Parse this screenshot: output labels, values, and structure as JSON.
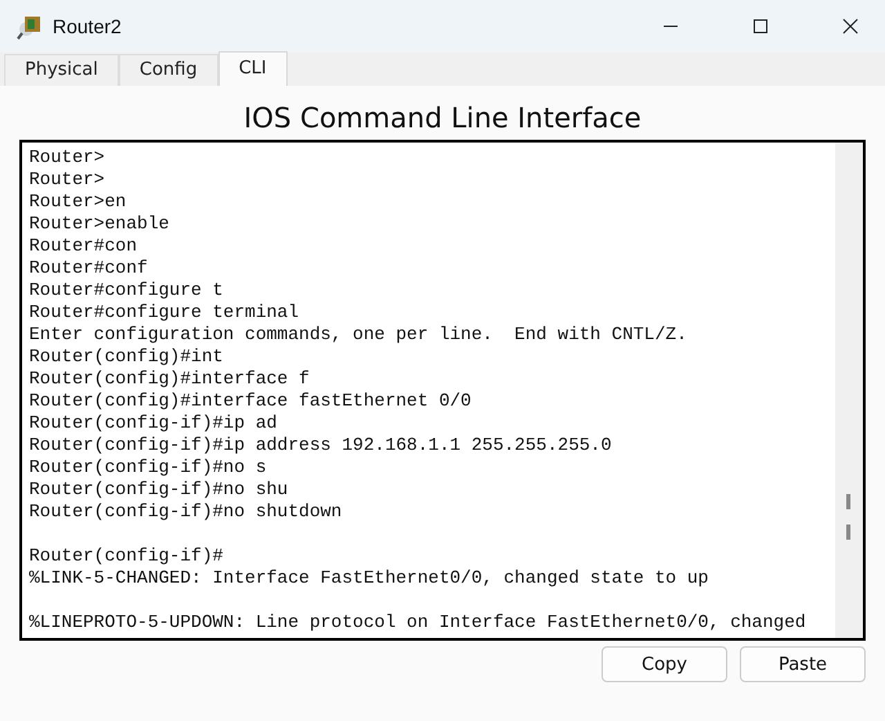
{
  "window": {
    "title": "Router2"
  },
  "tabs": [
    {
      "label": "Physical",
      "selected": false
    },
    {
      "label": "Config",
      "selected": false
    },
    {
      "label": "CLI",
      "selected": true
    }
  ],
  "heading": "IOS Command Line Interface",
  "terminal": {
    "blocks": [
      [
        "Router>",
        "Router>",
        "Router>en",
        "Router>enable",
        "Router#con",
        "Router#conf",
        "Router#configure t",
        "Router#configure terminal",
        "Enter configuration commands, one per line.  End with CNTL/Z.",
        "Router(config)#int",
        "Router(config)#interface f",
        "Router(config)#interface fastEthernet 0/0",
        "Router(config-if)#ip ad",
        "Router(config-if)#ip address 192.168.1.1 255.255.255.0",
        "Router(config-if)#no s",
        "Router(config-if)#no shu",
        "Router(config-if)#no shutdown"
      ],
      [
        "Router(config-if)#",
        "%LINK-5-CHANGED: Interface FastEthernet0/0, changed state to up"
      ],
      [
        "%LINEPROTO-5-UPDOWN: Line protocol on Interface FastEthernet0/0, changed"
      ]
    ]
  },
  "buttons": [
    "Copy",
    "Paste"
  ]
}
